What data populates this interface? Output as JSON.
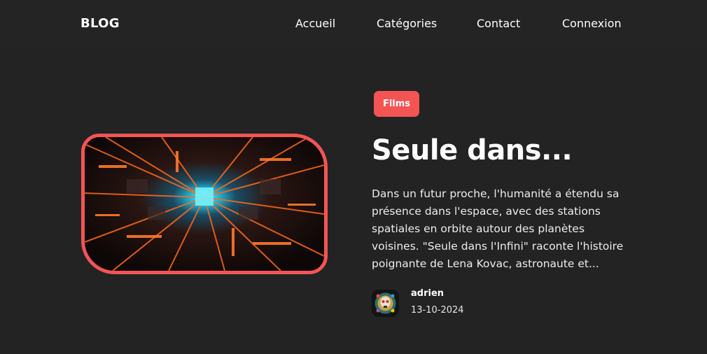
{
  "nav": {
    "brand": "BLOG",
    "links": [
      "Accueil",
      "Catégories",
      "Contact",
      "Connexion"
    ]
  },
  "post": {
    "category": "Films",
    "title": "Seule dans...",
    "excerpt_lines": [
      "Dans un futur proche, l'humanité a étendu sa",
      "présence dans l'espace, avec des stations",
      "spatiales en orbite autour des planètes",
      "voisines. \"Seule dans l'Infini\" raconte l'histoire",
      "poignante de Lena Kovac, astronaute et..."
    ],
    "author": "adrien",
    "date": "13-10-2024",
    "image_icon": "sci-fi-tunnel-image",
    "avatar_icon": "decorated-skull-avatar"
  },
  "colors": {
    "background": "#232323",
    "navbar": "#242424",
    "accent": "#f45454",
    "text": "#ffffff"
  }
}
